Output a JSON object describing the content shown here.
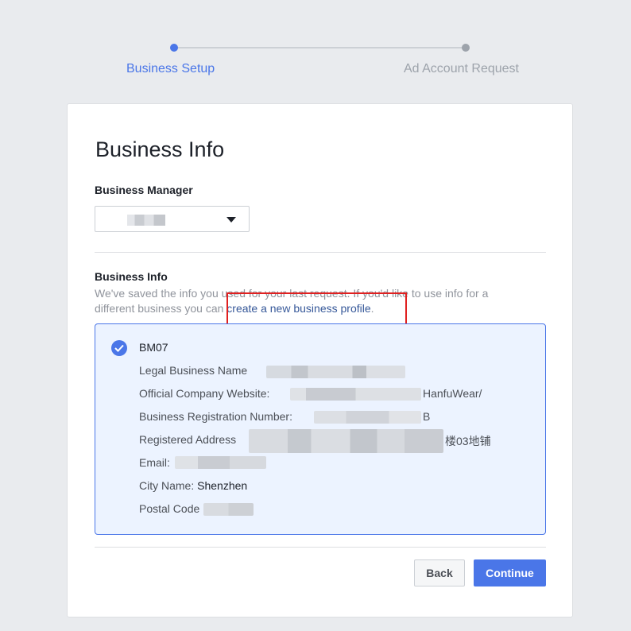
{
  "stepper": {
    "steps": [
      {
        "label": "Business Setup",
        "state": "active"
      },
      {
        "label": "Ad Account Request",
        "state": "inactive"
      }
    ]
  },
  "card": {
    "title": "Business Info",
    "business_manager": {
      "label": "Business Manager"
    },
    "business_info": {
      "label": "Business Info",
      "description_prefix": "We've saved the info you used for your last request. If you'd like to use info for a different business you can ",
      "link_text": "create a new business profile",
      "description_suffix": "."
    },
    "profile": {
      "name": "BM07",
      "rows": [
        {
          "label": "Legal Business Name",
          "value": ""
        },
        {
          "label": "Official Company Website:",
          "value": "HanfuWear/"
        },
        {
          "label": "Business Registration Number:",
          "value": "B"
        },
        {
          "label": "Registered Address",
          "value": "楼03地铺"
        },
        {
          "label": "Email:",
          "value": ""
        },
        {
          "label": "City Name:",
          "value": "Shenzhen"
        },
        {
          "label": "Postal Code",
          "value": ""
        }
      ]
    },
    "buttons": {
      "back": "Back",
      "continue": "Continue"
    }
  },
  "colors": {
    "accent": "#4a76e8",
    "highlight_box": "#e02020",
    "page_bg": "#e9ebee"
  }
}
